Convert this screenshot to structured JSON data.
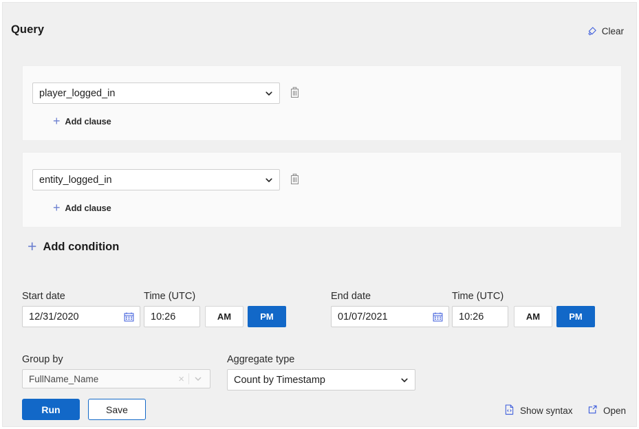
{
  "header": {
    "title": "Query",
    "clear_label": "Clear",
    "clear_icon": "eraser-icon"
  },
  "conditions": [
    {
      "select_value": "player_logged_in",
      "add_clause_label": "Add clause",
      "delete_icon": "trash-icon"
    },
    {
      "select_value": "entity_logged_in",
      "add_clause_label": "Add clause",
      "delete_icon": "trash-icon"
    }
  ],
  "add_condition_label": "Add condition",
  "daterange": {
    "start": {
      "date_label": "Start date",
      "date_value": "12/31/2020",
      "time_label": "Time (UTC)",
      "time_value": "10:26",
      "am_label": "AM",
      "pm_label": "PM",
      "meridiem_selected": "PM"
    },
    "end": {
      "date_label": "End date",
      "date_value": "01/07/2021",
      "time_label": "Time (UTC)",
      "time_value": "10:26",
      "am_label": "AM",
      "pm_label": "PM",
      "meridiem_selected": "PM"
    },
    "calendar_icon": "calendar-icon"
  },
  "groupby": {
    "label": "Group by",
    "value": "FullName_Name",
    "clear_glyph": "×"
  },
  "aggregate": {
    "label": "Aggregate type",
    "value": "Count by Timestamp"
  },
  "footer": {
    "run_label": "Run",
    "save_label": "Save",
    "show_syntax_label": "Show syntax",
    "show_syntax_icon": "code-file-icon",
    "open_label": "Open",
    "open_icon": "external-link-icon"
  },
  "colors": {
    "accent_blue": "#1268c8",
    "link_blue": "#3b5bdb",
    "plus_blue": "#6b7fd0",
    "page_bg": "#f0f0f0",
    "card_bg": "#fafafa"
  }
}
